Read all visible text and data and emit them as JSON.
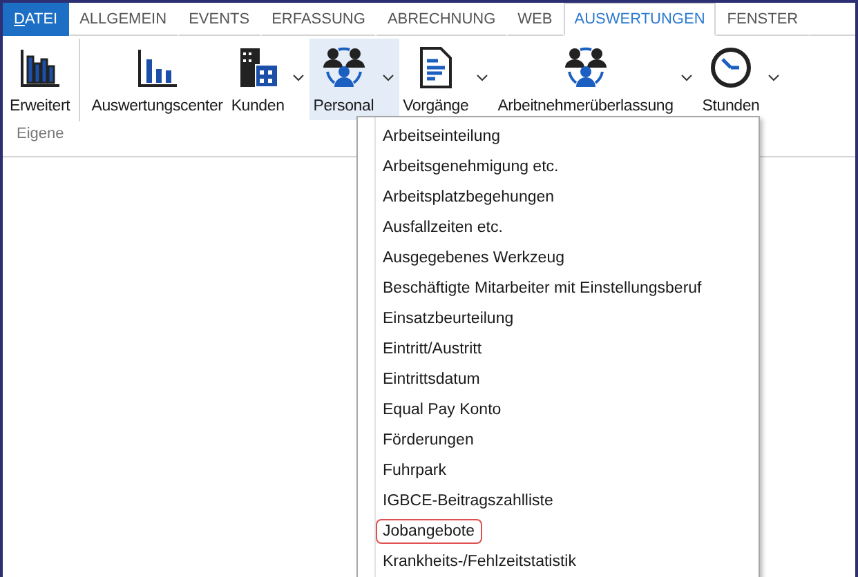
{
  "tabs": [
    {
      "label": "DATEI",
      "kind": "file",
      "selected": false
    },
    {
      "label": "ALLGEMEIN",
      "kind": "tab",
      "selected": false
    },
    {
      "label": "EVENTS",
      "kind": "tab",
      "selected": false
    },
    {
      "label": "ERFASSUNG",
      "kind": "tab",
      "selected": false
    },
    {
      "label": "ABRECHNUNG",
      "kind": "tab",
      "selected": false
    },
    {
      "label": "WEB",
      "kind": "tab",
      "selected": false
    },
    {
      "label": "AUSWERTUNGEN",
      "kind": "tab",
      "selected": true
    },
    {
      "label": "FENSTER",
      "kind": "tab",
      "selected": false
    }
  ],
  "groups": [
    {
      "label": "Eigene",
      "buttons": [
        {
          "label": "Erweitert",
          "kind": "bars-detailed",
          "dropdown": false,
          "selected": false
        }
      ]
    },
    {
      "buttons": [
        {
          "label": "Auswertungscenter",
          "kind": "bars",
          "dropdown": false,
          "selected": false
        },
        {
          "label": "Kunden",
          "kind": "buildings",
          "dropdown": true,
          "selected": false
        },
        {
          "label": "Personal",
          "kind": "people",
          "dropdown": true,
          "selected": true
        },
        {
          "label": "Vorgänge",
          "kind": "document",
          "dropdown": true,
          "selected": false
        },
        {
          "label": "Arbeitnehmerüberlassung",
          "kind": "people",
          "dropdown": true,
          "selected": false
        },
        {
          "label": "Stunden",
          "kind": "clock",
          "dropdown": true,
          "selected": false
        }
      ]
    }
  ],
  "menu": {
    "items": [
      {
        "label": "Arbeitseinteilung",
        "outlined": false
      },
      {
        "label": "Arbeitsgenehmigung etc.",
        "outlined": false
      },
      {
        "label": "Arbeitsplatzbegehungen",
        "outlined": false
      },
      {
        "label": "Ausfallzeiten etc.",
        "outlined": false
      },
      {
        "label": "Ausgegebenes Werkzeug",
        "outlined": false
      },
      {
        "label": "Beschäftigte Mitarbeiter mit Einstellungsberuf",
        "outlined": false
      },
      {
        "label": "Einsatzbeurteilung",
        "outlined": false
      },
      {
        "label": "Eintritt/Austritt",
        "outlined": false
      },
      {
        "label": "Eintrittsdatum",
        "outlined": false
      },
      {
        "label": "Equal Pay Konto",
        "outlined": false
      },
      {
        "label": "Förderungen",
        "outlined": false
      },
      {
        "label": "Fuhrpark",
        "outlined": false
      },
      {
        "label": "IGBCE-Beitragszahlliste",
        "outlined": false
      },
      {
        "label": "Jobangebote",
        "outlined": true
      },
      {
        "label": "Krankheits-/Fehlzeitstatistik",
        "outlined": false
      }
    ]
  }
}
